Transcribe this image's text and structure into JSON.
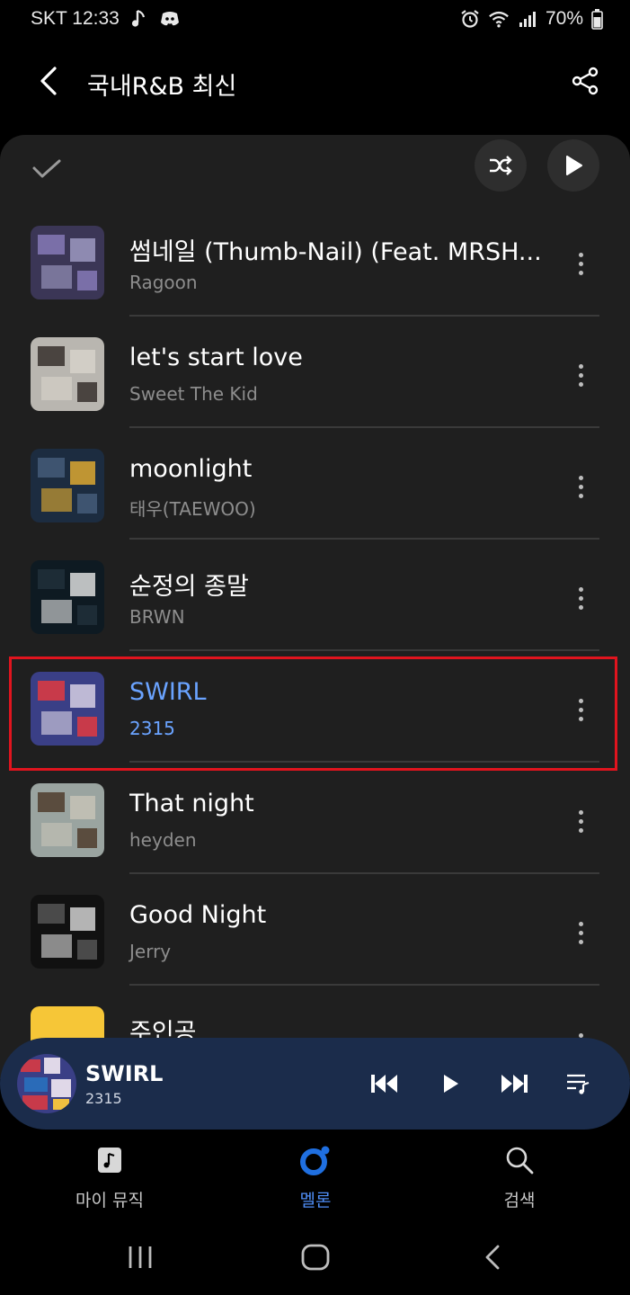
{
  "status_bar": {
    "carrier_time": "SKT 12:33",
    "battery": "70%",
    "icons": [
      "music-note-icon",
      "discord-icon",
      "alarm-icon",
      "wifi-icon",
      "signal-icon",
      "battery-icon"
    ]
  },
  "header": {
    "title": "국내R&B 최신",
    "back_icon": "back-arrow-icon",
    "share_icon": "share-icon"
  },
  "toolbar": {
    "select_icon": "checkmark-icon",
    "shuffle_icon": "shuffle-icon",
    "play_all_icon": "play-icon"
  },
  "songs": [
    {
      "title": "썸네일 (Thumb-Nail) (Feat. MRSH...",
      "artist": "Ragoon",
      "art_colors": [
        "#3b3656",
        "#7a6fa8",
        "#a4a0c8"
      ]
    },
    {
      "title": "let's start love",
      "artist": "Sweet The Kid",
      "art_colors": [
        "#b9b6b0",
        "#4a4440",
        "#d8d4cc"
      ]
    },
    {
      "title": "moonlight",
      "artist": "태우(TAEWOO)",
      "art_colors": [
        "#1c2c40",
        "#3e5470",
        "#e8b030"
      ]
    },
    {
      "title": "순정의 종말",
      "artist": "BRWN",
      "art_colors": [
        "#0e1a22",
        "#1d2c36",
        "#e8e8e8"
      ]
    },
    {
      "title": "SWIRL",
      "artist": "2315",
      "art_colors": [
        "#3a3f86",
        "#c83a4a",
        "#e0d8e8"
      ]
    },
    {
      "title": "That night",
      "artist": "heyden",
      "art_colors": [
        "#9aa4a0",
        "#5a4c3e",
        "#c8c4b8"
      ]
    },
    {
      "title": "Good Night",
      "artist": "Jerry",
      "art_colors": [
        "#111111",
        "#4a4a4a",
        "#dddddd"
      ]
    },
    {
      "title": "주인공",
      "artist": "",
      "art_colors": [
        "#f6c637",
        "#f6c637",
        "#f6c637"
      ]
    }
  ],
  "active_song_index": 4,
  "colors": {
    "accent_blue": "#4f8ef7",
    "active_text": "#6aa3ff",
    "highlight_border": "#e0141e",
    "mini_player_bg": "#1b2c4b"
  },
  "now_playing": {
    "title": "SWIRL",
    "artist": "2315",
    "controls": [
      "previous-icon",
      "play-icon",
      "next-icon",
      "queue-icon"
    ]
  },
  "bottom_nav": [
    {
      "label": "마이 뮤직",
      "icon": "my-music-icon",
      "active": false
    },
    {
      "label": "멜론",
      "icon": "melon-icon",
      "active": true
    },
    {
      "label": "검색",
      "icon": "search-icon",
      "active": false
    }
  ],
  "system_nav": [
    "recents-icon",
    "home-icon",
    "back-icon"
  ]
}
